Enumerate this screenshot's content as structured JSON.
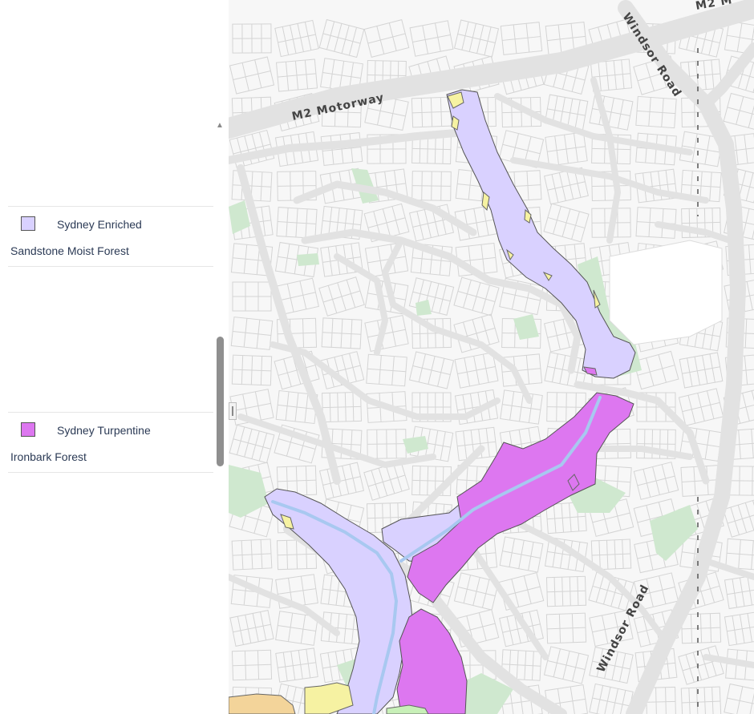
{
  "legend": {
    "items": [
      {
        "line1": "Sydney Enriched",
        "line2": "Sandstone Moist Forest",
        "color": "#d9d1ff"
      },
      {
        "line1": "Sydney Turpentine",
        "line2": "Ironbark Forest",
        "color": "#dd77f0"
      }
    ]
  },
  "map": {
    "road_labels": {
      "m2_motorway": "M2 Motorway",
      "windsor_road_top": "Windsor Road",
      "windsor_road_bottom": "Windsor Road",
      "m2_corner": "M2 M"
    },
    "colors": {
      "background": "#f7f7f7",
      "road": "#e2e2e2",
      "parcel_line": "#d4d4d4",
      "green_space": "#cfe8cf",
      "enriched_sandstone": "#d9d1ff",
      "turpentine_ironbark": "#dd77f0",
      "other_yellow": "#f6f2a2",
      "other_orange": "#f3d49a",
      "creek": "#a8c8f0"
    }
  }
}
